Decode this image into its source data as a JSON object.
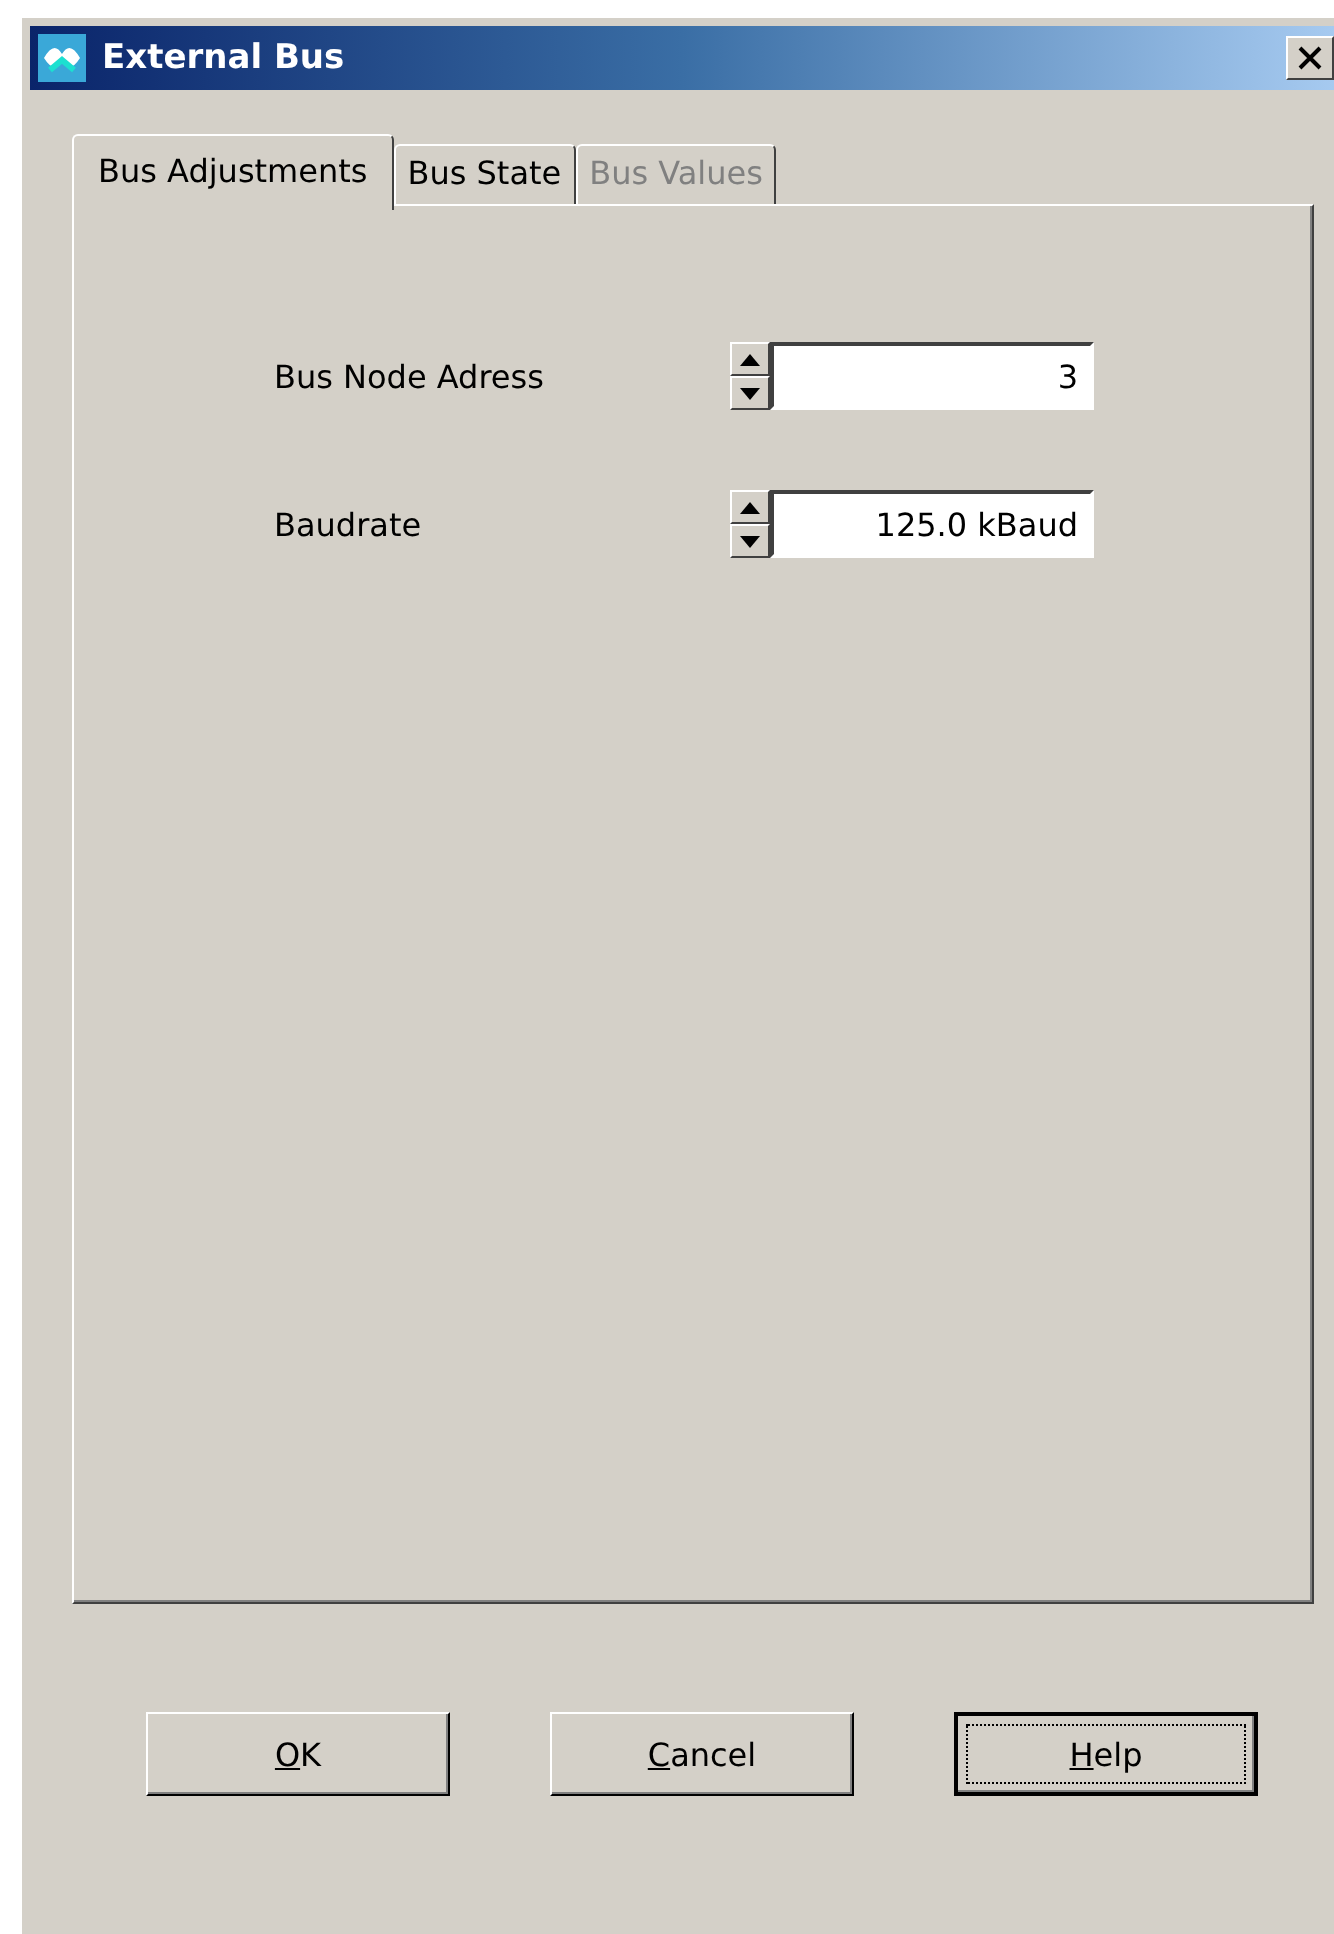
{
  "window": {
    "title": "External Bus"
  },
  "tabs": [
    {
      "label": "Bus Adjustments",
      "selected": true,
      "disabled": false
    },
    {
      "label": "Bus State",
      "selected": false,
      "disabled": false
    },
    {
      "label": "Bus Values",
      "selected": false,
      "disabled": true
    }
  ],
  "fields": [
    {
      "label": "Bus Node Adress",
      "value": "3"
    },
    {
      "label": "Baudrate",
      "value": "125.0 kBaud"
    }
  ],
  "buttons": [
    {
      "label": "OK",
      "focused": false
    },
    {
      "label": "Cancel",
      "focused": false
    },
    {
      "label": "Help",
      "focused": true
    }
  ]
}
